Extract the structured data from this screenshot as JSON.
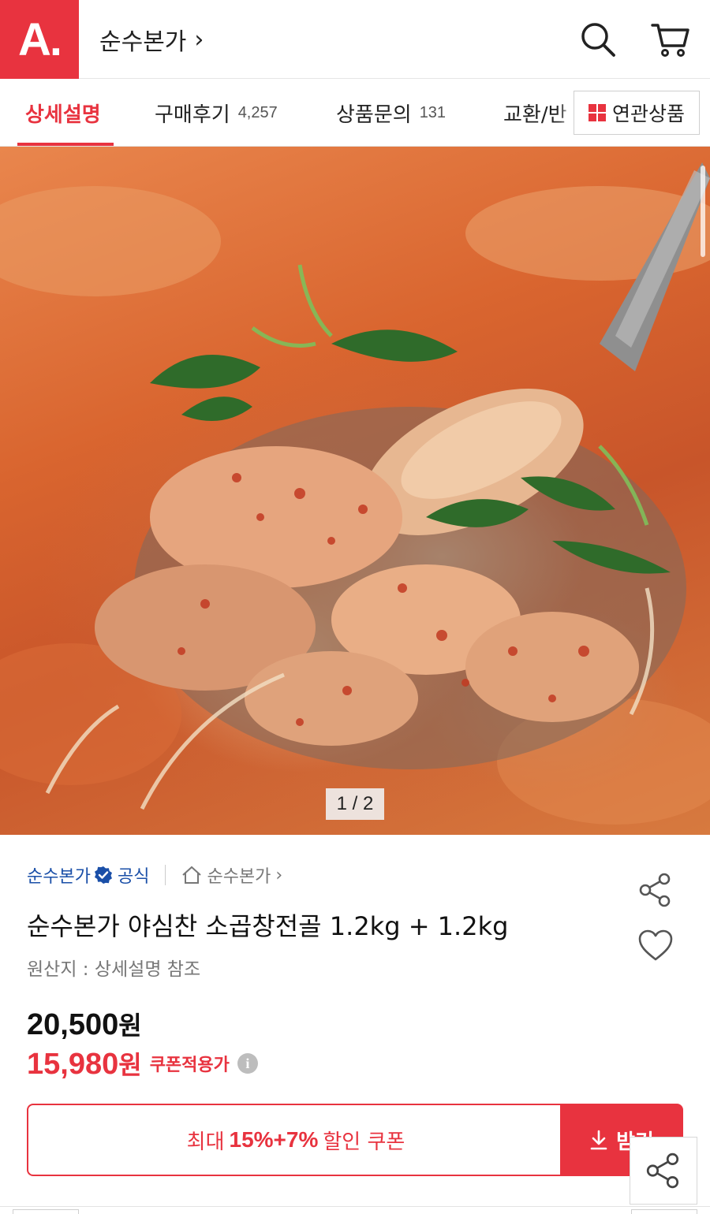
{
  "header": {
    "logo_text": "A.",
    "store_name": "순수본가",
    "store_chevron": "›"
  },
  "tabs": [
    {
      "label": "상세설명",
      "count": ""
    },
    {
      "label": "구매후기",
      "count": "4,257"
    },
    {
      "label": "상품문의",
      "count": "131"
    },
    {
      "label": "교환/반",
      "count": ""
    }
  ],
  "related_button": {
    "label": "연관상품"
  },
  "gallery": {
    "pager": "1 / 2"
  },
  "product": {
    "seller": "순수본가",
    "official_label": "공식",
    "home_store": "순수본가",
    "home_chevron": "›",
    "title": "순수본가 야심찬 소곱창전골 1.2kg + 1.2kg",
    "origin": "원산지 : 상세설명 참조",
    "original_price": "20,500",
    "sale_price": "15,980",
    "currency": "원",
    "coupon_applied_label": "쿠폰적용가",
    "info_glyph": "i"
  },
  "coupon": {
    "prefix": "최대",
    "rate": "15%+7%",
    "suffix": "할인 쿠폰",
    "download_label": "받기"
  },
  "colors": {
    "brand_red": "#e8333f",
    "seller_blue": "#1a4fa8"
  }
}
